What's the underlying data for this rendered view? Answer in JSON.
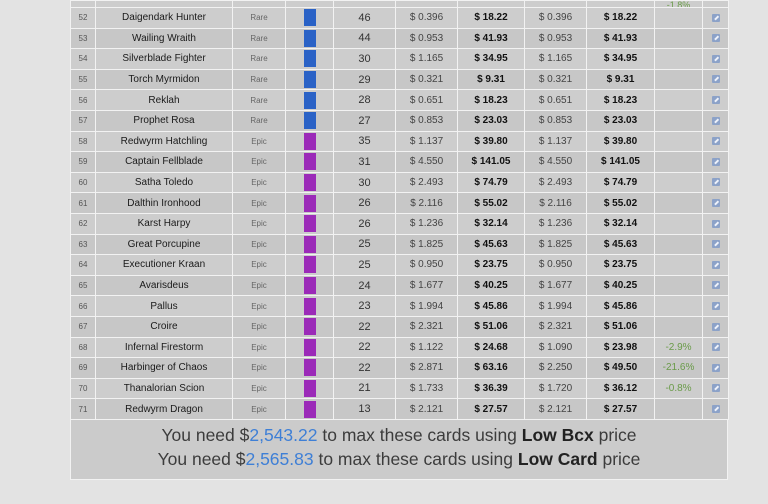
{
  "colors": {
    "rare": "#2a62c6",
    "epic": "#9b2ab8",
    "change": "#6a9b49",
    "amount": "#3e7fd6"
  },
  "top_partial": {
    "change": "-1.8%"
  },
  "rows": [
    {
      "id": "52",
      "name": "Daigendark Hunter",
      "rarity": "Rare",
      "count": "46",
      "bcx_unit": "$ 0.396",
      "bcx_total": "$ 18.22",
      "card_unit": "$ 0.396",
      "card_total": "$ 18.22",
      "change": ""
    },
    {
      "id": "53",
      "name": "Wailing Wraith",
      "rarity": "Rare",
      "count": "44",
      "bcx_unit": "$ 0.953",
      "bcx_total": "$ 41.93",
      "card_unit": "$ 0.953",
      "card_total": "$ 41.93",
      "change": ""
    },
    {
      "id": "54",
      "name": "Silverblade Fighter",
      "rarity": "Rare",
      "count": "30",
      "bcx_unit": "$ 1.165",
      "bcx_total": "$ 34.95",
      "card_unit": "$ 1.165",
      "card_total": "$ 34.95",
      "change": ""
    },
    {
      "id": "55",
      "name": "Torch Myrmidon",
      "rarity": "Rare",
      "count": "29",
      "bcx_unit": "$ 0.321",
      "bcx_total": "$ 9.31",
      "card_unit": "$ 0.321",
      "card_total": "$ 9.31",
      "change": ""
    },
    {
      "id": "56",
      "name": "Reklah",
      "rarity": "Rare",
      "count": "28",
      "bcx_unit": "$ 0.651",
      "bcx_total": "$ 18.23",
      "card_unit": "$ 0.651",
      "card_total": "$ 18.23",
      "change": ""
    },
    {
      "id": "57",
      "name": "Prophet Rosa",
      "rarity": "Rare",
      "count": "27",
      "bcx_unit": "$ 0.853",
      "bcx_total": "$ 23.03",
      "card_unit": "$ 0.853",
      "card_total": "$ 23.03",
      "change": ""
    },
    {
      "id": "58",
      "name": "Redwyrm Hatchling",
      "rarity": "Epic",
      "count": "35",
      "bcx_unit": "$ 1.137",
      "bcx_total": "$ 39.80",
      "card_unit": "$ 1.137",
      "card_total": "$ 39.80",
      "change": ""
    },
    {
      "id": "59",
      "name": "Captain Fellblade",
      "rarity": "Epic",
      "count": "31",
      "bcx_unit": "$ 4.550",
      "bcx_total": "$ 141.05",
      "card_unit": "$ 4.550",
      "card_total": "$ 141.05",
      "change": ""
    },
    {
      "id": "60",
      "name": "Satha Toledo",
      "rarity": "Epic",
      "count": "30",
      "bcx_unit": "$ 2.493",
      "bcx_total": "$ 74.79",
      "card_unit": "$ 2.493",
      "card_total": "$ 74.79",
      "change": ""
    },
    {
      "id": "61",
      "name": "Dalthin Ironhood",
      "rarity": "Epic",
      "count": "26",
      "bcx_unit": "$ 2.116",
      "bcx_total": "$ 55.02",
      "card_unit": "$ 2.116",
      "card_total": "$ 55.02",
      "change": ""
    },
    {
      "id": "62",
      "name": "Karst Harpy",
      "rarity": "Epic",
      "count": "26",
      "bcx_unit": "$ 1.236",
      "bcx_total": "$ 32.14",
      "card_unit": "$ 1.236",
      "card_total": "$ 32.14",
      "change": ""
    },
    {
      "id": "63",
      "name": "Great Porcupine",
      "rarity": "Epic",
      "count": "25",
      "bcx_unit": "$ 1.825",
      "bcx_total": "$ 45.63",
      "card_unit": "$ 1.825",
      "card_total": "$ 45.63",
      "change": ""
    },
    {
      "id": "64",
      "name": "Executioner Kraan",
      "rarity": "Epic",
      "count": "25",
      "bcx_unit": "$ 0.950",
      "bcx_total": "$ 23.75",
      "card_unit": "$ 0.950",
      "card_total": "$ 23.75",
      "change": ""
    },
    {
      "id": "65",
      "name": "Avarisdeus",
      "rarity": "Epic",
      "count": "24",
      "bcx_unit": "$ 1.677",
      "bcx_total": "$ 40.25",
      "card_unit": "$ 1.677",
      "card_total": "$ 40.25",
      "change": ""
    },
    {
      "id": "66",
      "name": "Pallus",
      "rarity": "Epic",
      "count": "23",
      "bcx_unit": "$ 1.994",
      "bcx_total": "$ 45.86",
      "card_unit": "$ 1.994",
      "card_total": "$ 45.86",
      "change": ""
    },
    {
      "id": "67",
      "name": "Croire",
      "rarity": "Epic",
      "count": "22",
      "bcx_unit": "$ 2.321",
      "bcx_total": "$ 51.06",
      "card_unit": "$ 2.321",
      "card_total": "$ 51.06",
      "change": ""
    },
    {
      "id": "68",
      "name": "Infernal Firestorm",
      "rarity": "Epic",
      "count": "22",
      "bcx_unit": "$ 1.122",
      "bcx_total": "$ 24.68",
      "card_unit": "$ 1.090",
      "card_total": "$ 23.98",
      "change": "-2.9%"
    },
    {
      "id": "69",
      "name": "Harbinger of Chaos",
      "rarity": "Epic",
      "count": "22",
      "bcx_unit": "$ 2.871",
      "bcx_total": "$ 63.16",
      "card_unit": "$ 2.250",
      "card_total": "$ 49.50",
      "change": "-21.6%"
    },
    {
      "id": "70",
      "name": "Thanalorian Scion",
      "rarity": "Epic",
      "count": "21",
      "bcx_unit": "$ 1.733",
      "bcx_total": "$ 36.39",
      "card_unit": "$ 1.720",
      "card_total": "$ 36.12",
      "change": "-0.8%"
    },
    {
      "id": "71",
      "name": "Redwyrm Dragon",
      "rarity": "Epic",
      "count": "13",
      "bcx_unit": "$ 2.121",
      "bcx_total": "$ 27.57",
      "card_unit": "$ 2.121",
      "card_total": "$ 27.57",
      "change": ""
    }
  ],
  "summary": {
    "line1": {
      "prefix": "You need $",
      "amount": "2,543.22",
      "middle": " to max these cards using ",
      "kind": "Low Bcx",
      "suffix": " price"
    },
    "line2": {
      "prefix": "You need $",
      "amount": "2,565.83",
      "middle": " to max these cards using ",
      "kind": "Low Card",
      "suffix": " price"
    }
  }
}
